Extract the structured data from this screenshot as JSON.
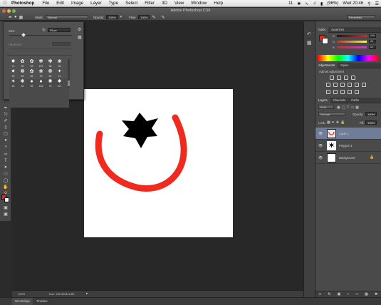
{
  "menubar": {
    "app": "Photoshop",
    "items": [
      "File",
      "Edit",
      "Image",
      "Layer",
      "Type",
      "Select",
      "Filter",
      "3D",
      "View",
      "Window",
      "Help"
    ],
    "status_badge": "11",
    "battery": "(96%)",
    "clock": "Wed 20:46"
  },
  "window": {
    "title": "Adobe Photoshop CS6"
  },
  "options": {
    "mode_label": "Mode:",
    "mode_value": "Normal",
    "opacity_label": "Opacity:",
    "opacity_value": "100%",
    "flow_label": "Flow:",
    "flow_value": "100%",
    "workspace": "Essentials"
  },
  "brush_popup": {
    "size_label": "Size:",
    "size_value": "35 px",
    "hardness_label": "Hardness:",
    "tips": [
      {
        "glyph": "✸",
        "num": "74"
      },
      {
        "glyph": "✿",
        "num": "95"
      },
      {
        "glyph": "✿",
        "num": "29"
      },
      {
        "glyph": "✾",
        "num": "192"
      },
      {
        "glyph": "✾",
        "num": "36"
      },
      {
        "glyph": "❀",
        "num": "36"
      },
      {
        "glyph": "✷",
        "num": "33"
      },
      {
        "glyph": "❁",
        "num": "63"
      },
      {
        "glyph": "✿",
        "num": "66"
      },
      {
        "glyph": "❀",
        "num": "39"
      },
      {
        "glyph": "❁",
        "num": "63"
      },
      {
        "glyph": "✦",
        "num": "11"
      },
      {
        "glyph": "✶",
        "num": "48"
      },
      {
        "glyph": "❃",
        "num": "32"
      },
      {
        "glyph": "●",
        "num": "55"
      },
      {
        "glyph": "●",
        "num": "100"
      },
      {
        "glyph": "✺",
        "num": "75"
      },
      {
        "glyph": "✸",
        "num": "107"
      }
    ]
  },
  "status": {
    "zoom": "100%",
    "doc": "Doc: 752.4K/512.8K"
  },
  "bottom_tabs": [
    "Mini Bridge",
    "Timeline"
  ],
  "color_panel": {
    "tabs": [
      "Color",
      "Swatches"
    ],
    "channels": [
      {
        "label": "R",
        "value": "249"
      },
      {
        "label": "G",
        "value": "24"
      },
      {
        "label": "B",
        "value": "24"
      }
    ]
  },
  "adjustments_panel": {
    "tabs": [
      "Adjustments",
      "Styles"
    ],
    "subtitle": "Add an adjustment"
  },
  "layers_panel": {
    "tabs": [
      "Layers",
      "Channels",
      "Paths"
    ],
    "kind": "Kind",
    "blend_mode": "Normal",
    "opacity_label": "Opacity:",
    "opacity_value": "100%",
    "lock_label": "Lock:",
    "fill_label": "Fill:",
    "fill_value": "100%",
    "layers": [
      {
        "name": "Layer 1",
        "selected": true
      },
      {
        "name": "Polygon 1",
        "selected": false
      },
      {
        "name": "Background",
        "selected": false
      }
    ]
  },
  "colors": {
    "foreground": "#e8261b",
    "background": "#ffffff",
    "stroke": "#f02a1f"
  }
}
